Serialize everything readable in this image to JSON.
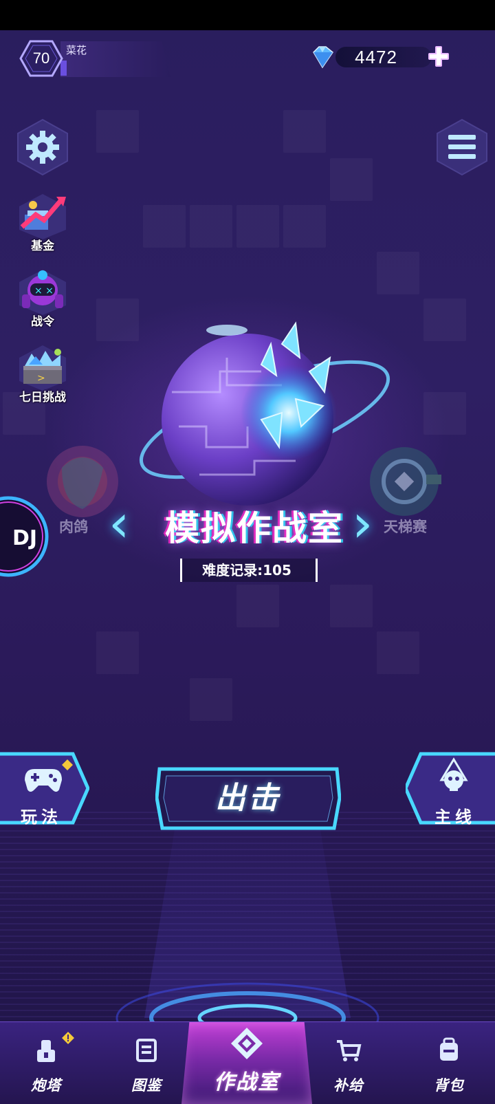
{
  "player": {
    "level": "70",
    "name": "菜花",
    "exp_fraction": 0.06
  },
  "currency": {
    "gems": "4472"
  },
  "left_menu": [
    {
      "label": "基金",
      "icon": "fund-chart-icon"
    },
    {
      "label": "战令",
      "icon": "robot-pass-icon"
    },
    {
      "label": "七日挑战",
      "icon": "crystal-chest-icon"
    }
  ],
  "modes": {
    "current": "模拟作战室",
    "prev": "肉鸽",
    "next": "天梯赛",
    "record_label": "难度记录:105"
  },
  "dj_badge": "DJ",
  "actions": {
    "play": "玩法",
    "attack": "出击",
    "main": "主线"
  },
  "nav": {
    "turret": "炮塔",
    "codex": "图鉴",
    "battle_room": "作战室",
    "supply": "补给",
    "backpack": "背包"
  },
  "colors": {
    "accent_cyan": "#49d8ff",
    "accent_magenta": "#d040e0",
    "background": "#2b1d60"
  }
}
